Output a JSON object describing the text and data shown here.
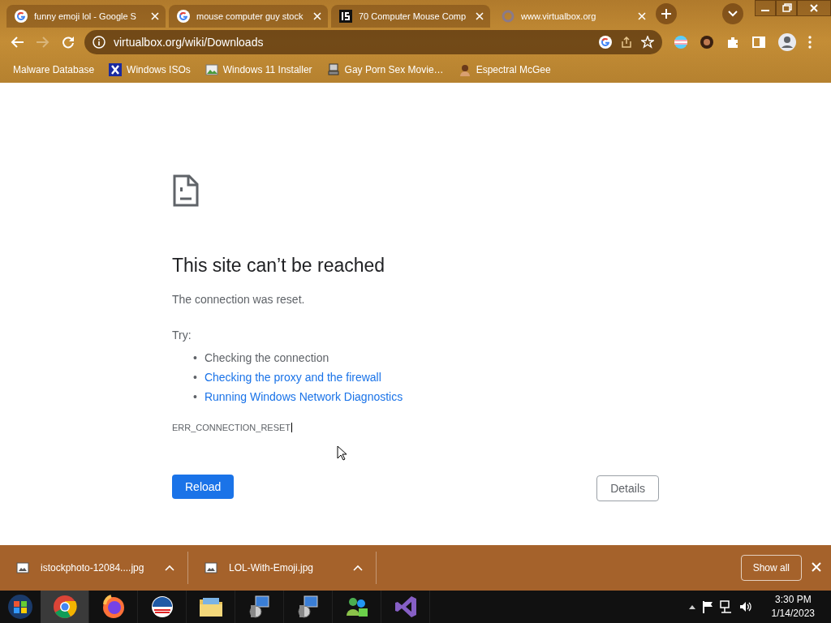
{
  "tabs": [
    {
      "title": "funny emoji lol - Google S",
      "kind": "google",
      "selected": false
    },
    {
      "title": "mouse computer guy stock",
      "kind": "google",
      "selected": false
    },
    {
      "title": "70 Computer Mouse Comp",
      "kind": "istock",
      "selected": false
    },
    {
      "title": "www.virtualbox.org",
      "kind": "loading",
      "selected": true
    }
  ],
  "address": {
    "url": "virtualbox.org/wiki/Downloads"
  },
  "bookmarks": [
    {
      "label": "Malware Database",
      "kind": "blank"
    },
    {
      "label": "Windows ISOs",
      "kind": "x"
    },
    {
      "label": "Windows 11 Installer",
      "kind": "image"
    },
    {
      "label": "Gay Porn Sex Movie…",
      "kind": "computer"
    },
    {
      "label": "Espectral McGee",
      "kind": "avatar"
    }
  ],
  "error": {
    "title": "This site can’t be reached",
    "message": "The connection was reset.",
    "try_label": "Try:",
    "suggestions": [
      {
        "marker": "•",
        "text": "Checking the connection",
        "link": false
      },
      {
        "marker": "•",
        "text": "Checking the proxy and the firewall",
        "link": true
      },
      {
        "marker": "•",
        "text": "Running Windows Network Diagnostics",
        "link": true
      }
    ],
    "code": "ERR_CONNECTION_RESET",
    "buttons": [
      {
        "label": "Reload",
        "kind": "primary"
      },
      {
        "label": "Details",
        "kind": "secondary"
      }
    ]
  },
  "downloads": {
    "items": [
      {
        "filename": "istockphoto-12084....jpg"
      },
      {
        "filename": "LOL-With-Emoji.jpg"
      }
    ],
    "show_all": "Show all"
  },
  "taskbar": {
    "apps": [
      {
        "kind": "chrome",
        "selected": true
      },
      {
        "kind": "firefox",
        "selected": false
      },
      {
        "kind": "logo",
        "selected": false
      },
      {
        "kind": "folder",
        "selected": false
      },
      {
        "kind": "installer",
        "selected": false
      },
      {
        "kind": "installer",
        "selected": false
      },
      {
        "kind": "messenger",
        "selected": false
      },
      {
        "kind": "studio",
        "selected": false
      }
    ],
    "time": "3:30 PM",
    "date": "1/14/2023"
  }
}
